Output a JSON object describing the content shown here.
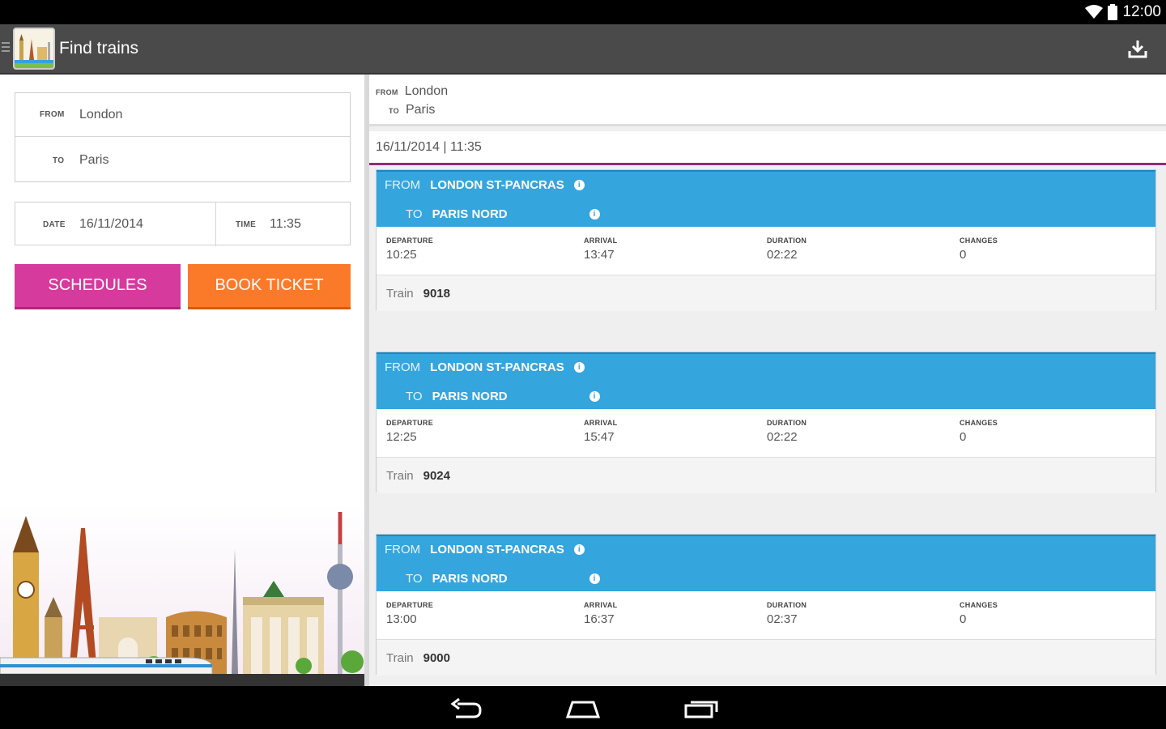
{
  "status_bar": {
    "time": "12:00"
  },
  "action_bar": {
    "title": "Find trains"
  },
  "search_form": {
    "from_label": "FROM",
    "from_value": "London",
    "to_label": "TO",
    "to_value": "Paris",
    "date_label": "DATE",
    "date_value": "16/11/2014",
    "time_label": "TIME",
    "time_value": "11:35"
  },
  "buttons": {
    "schedules": "SCHEDULES",
    "book_ticket": "BOOK TICKET"
  },
  "results_header": {
    "from_label": "FROM",
    "from_value": "London",
    "to_label": "TO",
    "to_value": "Paris",
    "datetime": "16/11/2014 | 11:35"
  },
  "labels": {
    "from": "FROM",
    "to": "TO",
    "departure": "DEPARTURE",
    "arrival": "ARRIVAL",
    "duration": "DURATION",
    "changes": "CHANGES",
    "train": "Train"
  },
  "trips": [
    {
      "from_station": "LONDON ST-PANCRAS",
      "to_station": "PARIS NORD",
      "departure": "10:25",
      "arrival": "13:47",
      "duration": "02:22",
      "changes": "0",
      "train": "9018"
    },
    {
      "from_station": "LONDON ST-PANCRAS",
      "to_station": "PARIS NORD",
      "departure": "12:25",
      "arrival": "15:47",
      "duration": "02:22",
      "changes": "0",
      "train": "9024"
    },
    {
      "from_station": "LONDON ST-PANCRAS",
      "to_station": "PARIS NORD",
      "departure": "13:00",
      "arrival": "16:37",
      "duration": "02:37",
      "changes": "0",
      "train": "9000"
    }
  ],
  "icons": {
    "wifi": "wifi-icon",
    "battery": "battery-icon",
    "download": "download-icon",
    "info": "info-icon",
    "back": "back-icon",
    "home": "home-icon",
    "recents": "recents-icon"
  },
  "colors": {
    "schedules": "#d63a9d",
    "book_ticket": "#fb7a2a",
    "card_header": "#35a5de",
    "accent_underline": "#8e2c7a"
  }
}
